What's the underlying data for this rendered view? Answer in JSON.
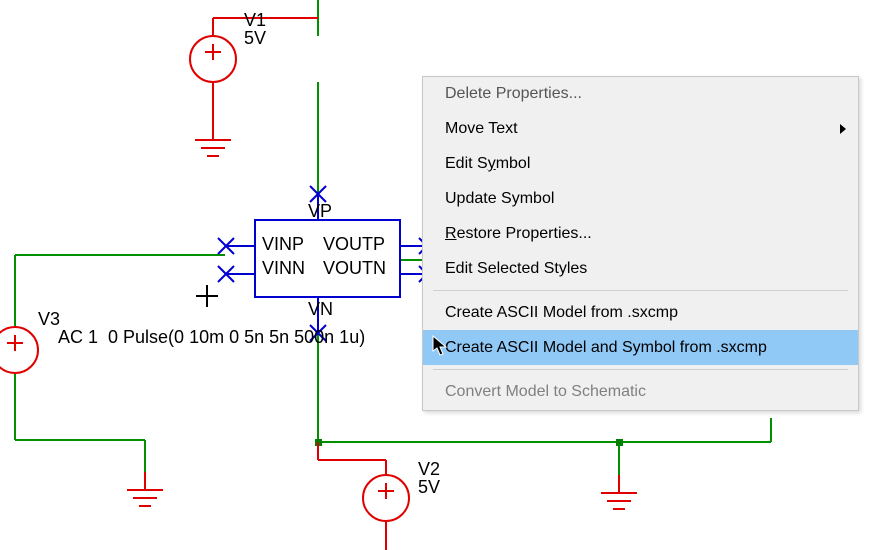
{
  "schematic": {
    "components": {
      "V1": {
        "ref": "V1",
        "value": "5V"
      },
      "V2": {
        "ref": "V2",
        "value": "5V"
      },
      "V3": {
        "ref": "V3",
        "params": "AC 1  0 Pulse(0 10m 0 5n 5n 500n 1u)"
      },
      "block": {
        "pins": {
          "top": "VP",
          "bottom": "VN",
          "left_top": "VINP",
          "left_bot": "VINN",
          "right_top": "VOUTP",
          "right_bot": "VOUTN"
        }
      }
    }
  },
  "menu": {
    "items": [
      {
        "label": "Delete Properties..."
      },
      {
        "label": "Move Text",
        "submenu": true
      },
      {
        "label": "Edit Symbol",
        "mnemonic_index": 6
      },
      {
        "label": "Update Symbol"
      },
      {
        "label": "Restore Properties...",
        "mnemonic_index": 0
      },
      {
        "label": "Edit Selected Styles"
      },
      {
        "sep": true
      },
      {
        "label": "Create ASCII Model from .sxcmp"
      },
      {
        "label": "Create ASCII Model and Symbol from .sxcmp",
        "highlight": true
      },
      {
        "sep": true
      },
      {
        "label": "Convert Model to Schematic",
        "disabled": true
      }
    ]
  }
}
